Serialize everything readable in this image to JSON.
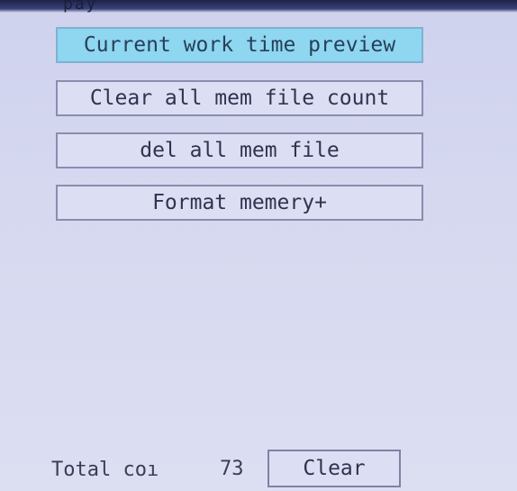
{
  "header": {
    "glyph": "pay"
  },
  "menu": {
    "items": [
      {
        "label": "Current work time preview",
        "selected": true
      },
      {
        "label": "Clear all mem file count",
        "selected": false
      },
      {
        "label": "del all mem file",
        "selected": false
      },
      {
        "label": "Format memery+",
        "selected": false
      }
    ]
  },
  "footer": {
    "total_label": "Total coı",
    "total_value": "73",
    "clear_label": "Clear"
  },
  "colors": {
    "background": "#d4d6ef",
    "selected_fill": "#8fd6f0",
    "button_border": "#8a8dae"
  }
}
